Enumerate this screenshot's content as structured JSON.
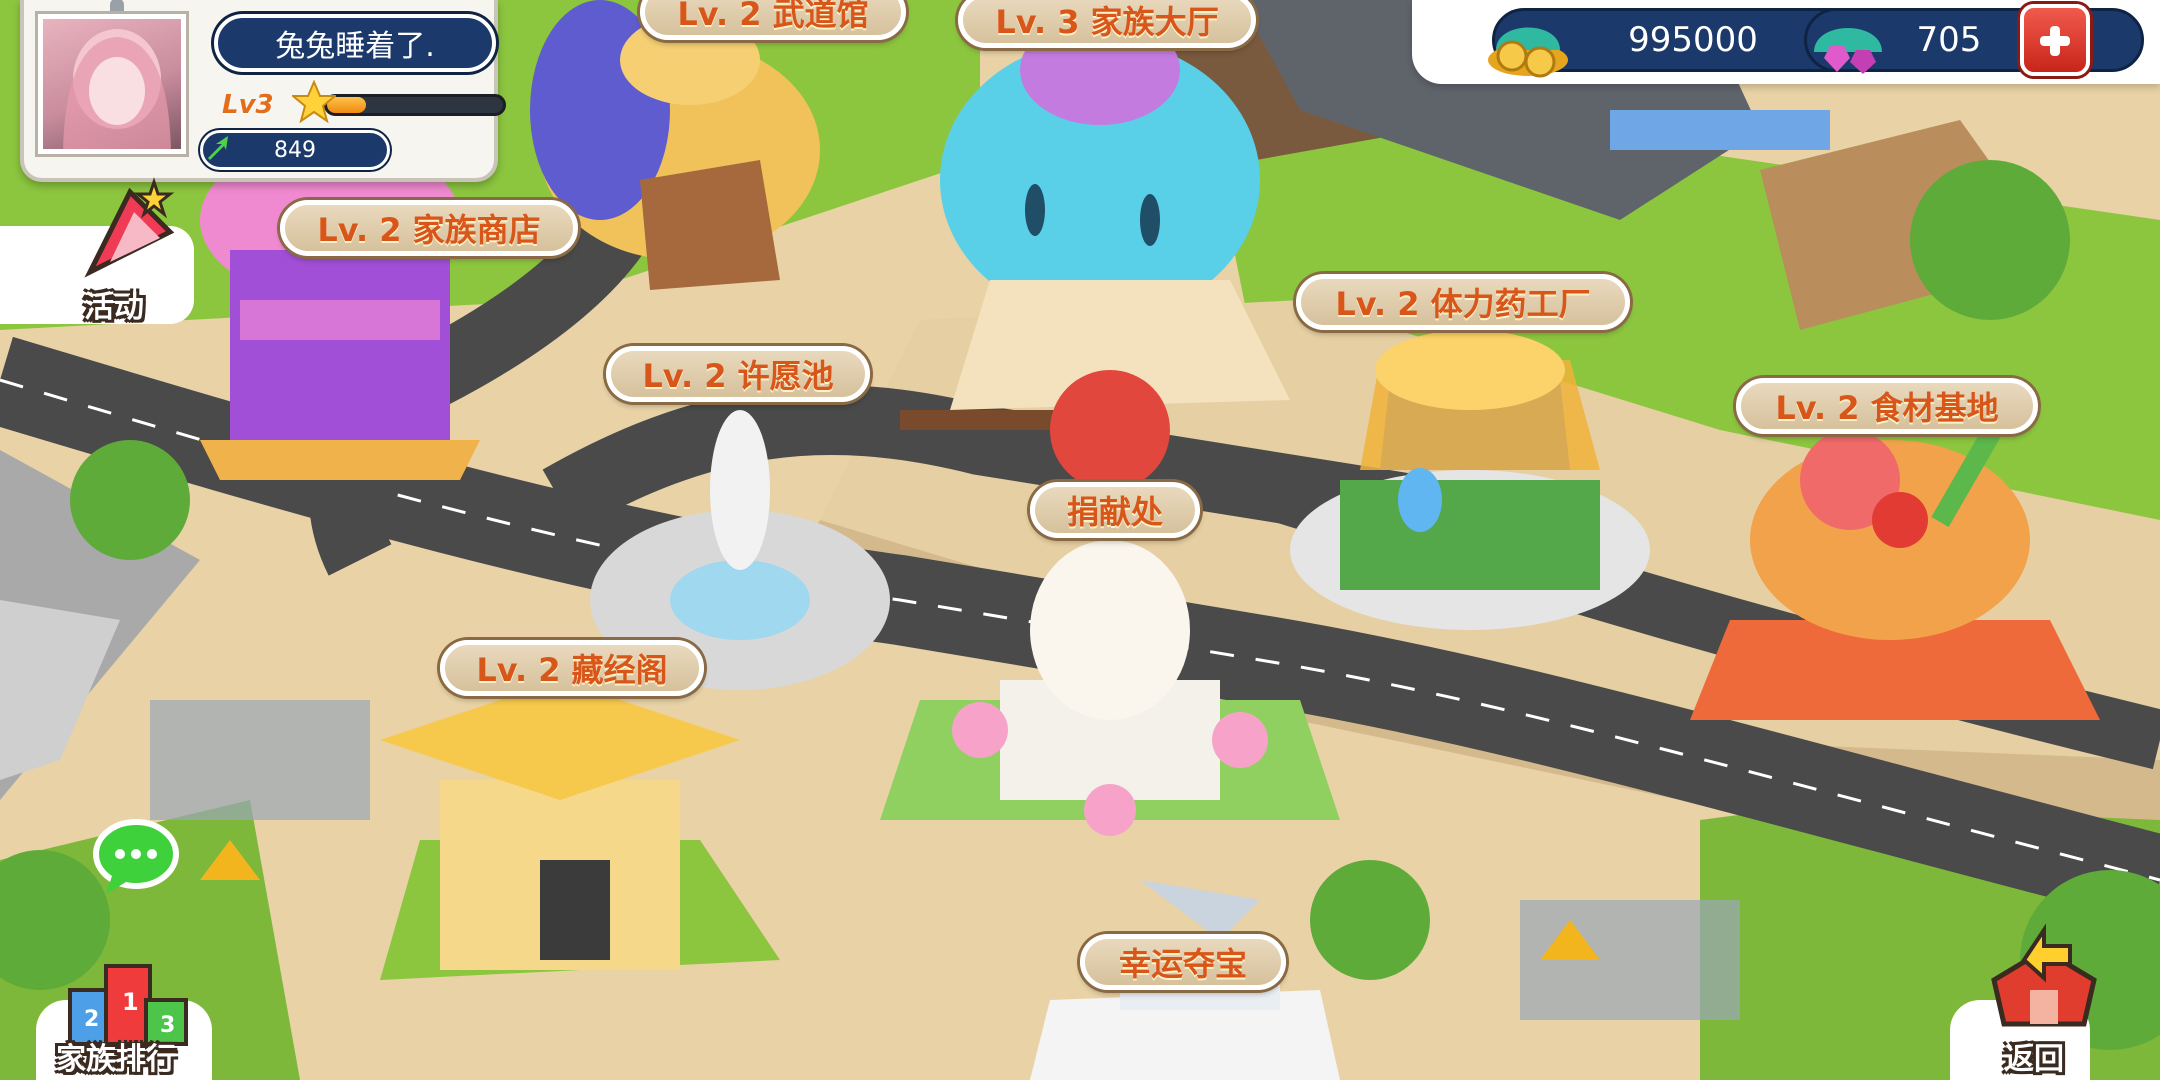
{
  "player": {
    "name": "兔兔睡着了.",
    "level_text": "Lv3",
    "xp_progress": 0.22,
    "energy": "849"
  },
  "currency": {
    "coins": "995000",
    "gems": "705"
  },
  "buildings": {
    "dojo": "Lv. 2  武道馆",
    "family_hall": "Lv. 3  家族大厅",
    "family_shop": "Lv. 2  家族商店",
    "potion_factory": "Lv. 2  体力药工厂",
    "wishing_pool": "Lv. 2  许愿池",
    "food_base": "Lv. 2  食材基地",
    "donation": "捐献处",
    "library": "Lv. 2  藏经阁",
    "lucky_treasure": "幸运夺宝"
  },
  "side_buttons": {
    "events": "活动",
    "family_ranking": "家族排行",
    "back": "返回"
  },
  "colors": {
    "label_text": "#d8561a",
    "panel_navy": "#1b3a6b",
    "grass": "#8cc63f",
    "road": "#4a4a4a",
    "sand": "#e8d2a6"
  }
}
